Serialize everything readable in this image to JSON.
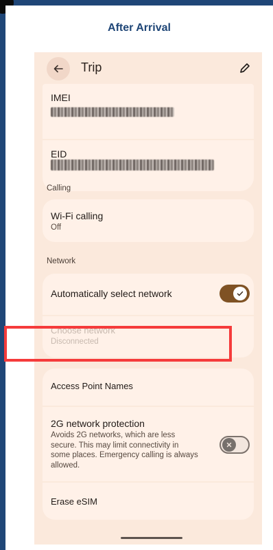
{
  "heading": "After Arrival",
  "appbar": {
    "title": "Trip"
  },
  "identity": {
    "imei_label": "IMEI",
    "eid_label": "EID"
  },
  "calling": {
    "section": "Calling",
    "wifi_title": "Wi-Fi calling",
    "wifi_value": "Off"
  },
  "network": {
    "section": "Network",
    "auto_select": "Automatically select network",
    "auto_select_on": true,
    "choose_title": "Choose network",
    "choose_sub": "Disconnected",
    "apn": "Access Point Names",
    "twog_title": "2G network protection",
    "twog_desc": "Avoids 2G networks, which are less secure. This may limit connectivity in some places. Emergency calling is always allowed.",
    "twog_on": false
  },
  "esim": {
    "erase": "Erase eSIM"
  },
  "colors": {
    "accent": "#7f5224",
    "highlight": "#f53b3b",
    "frame": "#1f4677"
  }
}
